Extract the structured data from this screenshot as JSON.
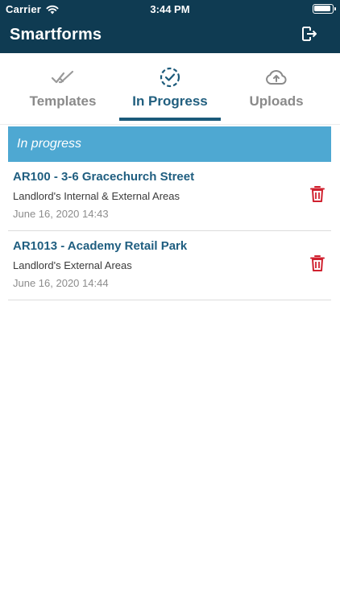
{
  "status_bar": {
    "carrier": "Carrier",
    "time": "3:44 PM"
  },
  "nav": {
    "title": "Smartforms"
  },
  "tabs": [
    {
      "label": "Templates",
      "icon": "double-check-icon",
      "active": false
    },
    {
      "label": "In Progress",
      "icon": "dashed-circle-check-icon",
      "active": true
    },
    {
      "label": "Uploads",
      "icon": "cloud-upload-icon",
      "active": false
    }
  ],
  "section": {
    "title": "In progress"
  },
  "items": [
    {
      "title": "AR100 - 3-6 Gracechurch Street",
      "subtitle": "Landlord's Internal & External Areas",
      "date": "June 16, 2020 14:43"
    },
    {
      "title": "AR1013 - Academy Retail Park",
      "subtitle": "Landlord's External Areas",
      "date": "June 16, 2020 14:44"
    }
  ],
  "colors": {
    "header": "#0f3b52",
    "active_tab": "#215f7f",
    "inactive_tab": "#8a8a8a",
    "section": "#4ea8d2",
    "delete": "#d0212f"
  }
}
